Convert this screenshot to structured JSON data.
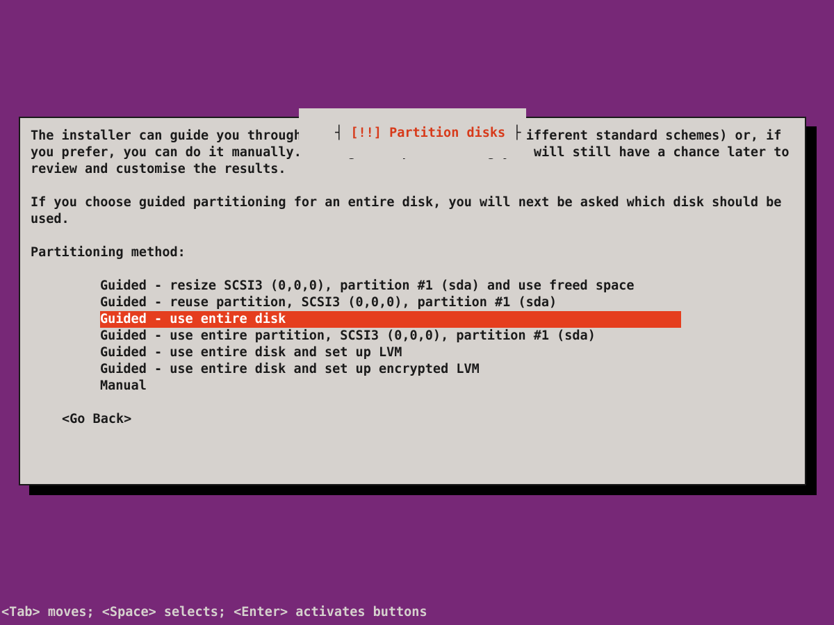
{
  "dialog": {
    "title_open": "┤ ",
    "title_marker": "[!!]",
    "title_text": " Partition disks",
    "title_close": " ├",
    "para1": "The installer can guide you through partitioning a disk (using different standard schemes) or, if you prefer, you can do it manually. With guided partitioning you will still have a chance later to review and customise the results.",
    "para2": "If you choose guided partitioning for an entire disk, you will next be asked which disk should be used.",
    "prompt": "Partitioning method:",
    "options": [
      "Guided - resize SCSI3 (0,0,0), partition #1 (sda) and use freed space",
      "Guided - reuse partition, SCSI3 (0,0,0), partition #1 (sda)",
      "Guided - use entire disk",
      "Guided - use entire partition, SCSI3 (0,0,0), partition #1 (sda)",
      "Guided - use entire disk and set up LVM",
      "Guided - use entire disk and set up encrypted LVM",
      "Manual"
    ],
    "selected_index": 2,
    "go_back": "<Go Back>"
  },
  "hint": "<Tab> moves; <Space> selects; <Enter> activates buttons"
}
